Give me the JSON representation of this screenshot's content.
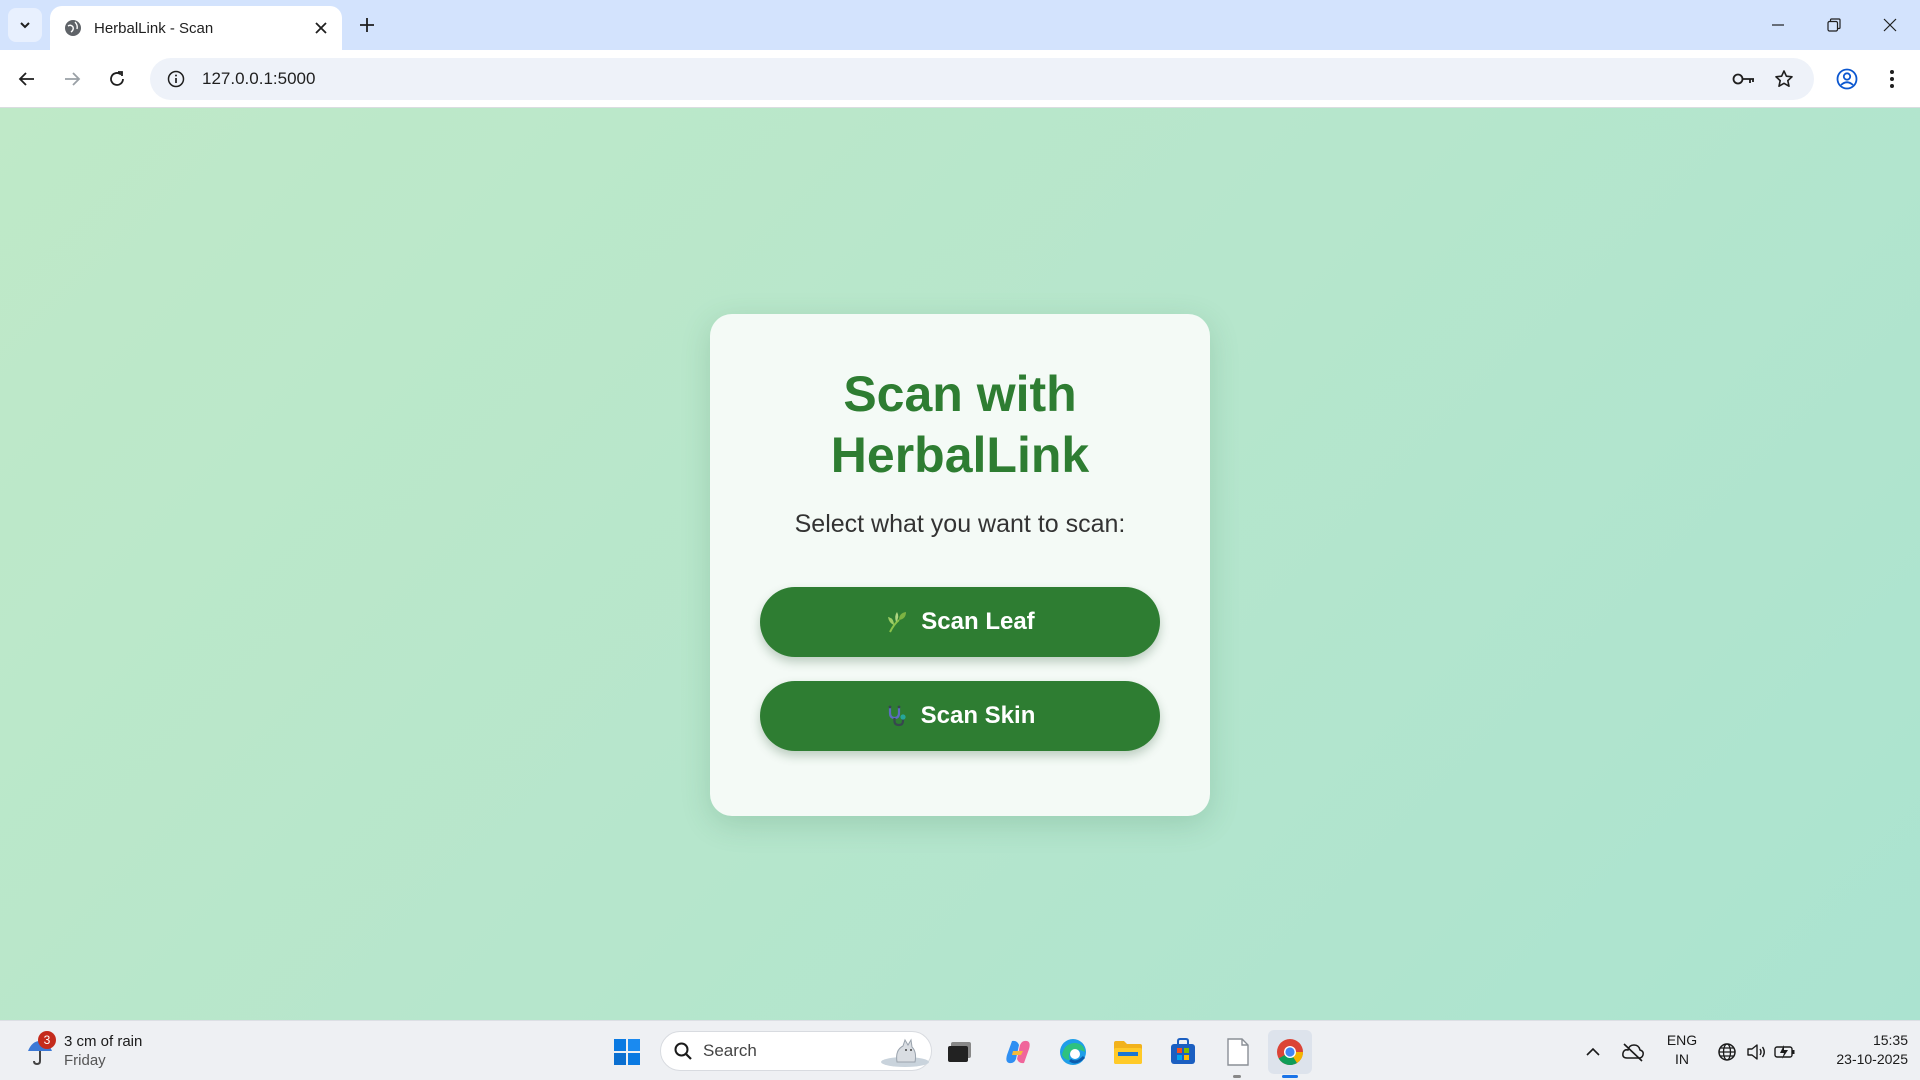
{
  "browser": {
    "tab_title": "HerbalLink - Scan",
    "url": "127.0.0.1:5000"
  },
  "page": {
    "heading": "Scan with HerbalLink",
    "subtitle": "Select what you want to scan:",
    "buttons": [
      {
        "label": "Scan Leaf",
        "icon": "leaf-icon"
      },
      {
        "label": "Scan Skin",
        "icon": "stethoscope-icon"
      }
    ],
    "colors": {
      "accent": "#2e7d32",
      "background": "#b6e6cc",
      "card": "#f4faf6"
    }
  },
  "taskbar": {
    "weather_text": "3 cm of rain",
    "weather_day": "Friday",
    "weather_badge": "3",
    "search_placeholder": "Search",
    "lang_top": "ENG",
    "lang_bottom": "IN",
    "time": "15:35",
    "date": "23-10-2025"
  }
}
